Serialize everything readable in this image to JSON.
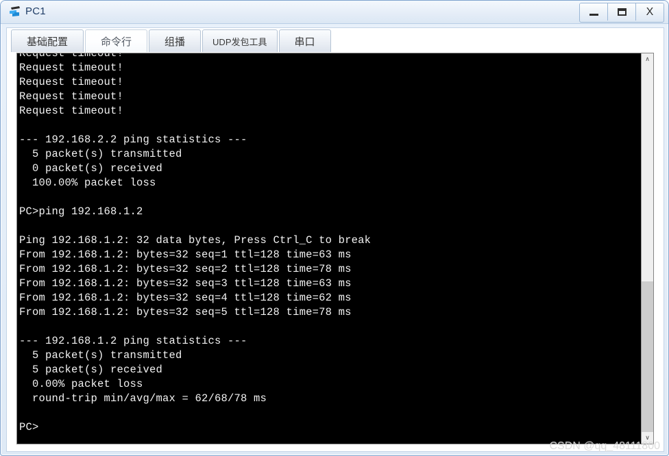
{
  "window": {
    "title": "PC1",
    "icon": "pc-device-icon",
    "controls": {
      "minimize": "—",
      "maximize": "❐",
      "close": "X"
    }
  },
  "tabs": [
    {
      "label": "基础配置",
      "active": false,
      "small": false
    },
    {
      "label": "命令行",
      "active": true,
      "small": false
    },
    {
      "label": "组播",
      "active": false,
      "small": false
    },
    {
      "label": "UDP发包工具",
      "active": false,
      "small": true
    },
    {
      "label": "串口",
      "active": false,
      "small": false
    }
  ],
  "console": {
    "lines": [
      "Request timeout!",
      "Request timeout!",
      "Request timeout!",
      "Request timeout!",
      "Request timeout!",
      "",
      "--- 192.168.2.2 ping statistics ---",
      "  5 packet(s) transmitted",
      "  0 packet(s) received",
      "  100.00% packet loss",
      "",
      "PC>ping 192.168.1.2",
      "",
      "Ping 192.168.1.2: 32 data bytes, Press Ctrl_C to break",
      "From 192.168.1.2: bytes=32 seq=1 ttl=128 time=63 ms",
      "From 192.168.1.2: bytes=32 seq=2 ttl=128 time=78 ms",
      "From 192.168.1.2: bytes=32 seq=3 ttl=128 time=63 ms",
      "From 192.168.1.2: bytes=32 seq=4 ttl=128 time=62 ms",
      "From 192.168.1.2: bytes=32 seq=5 ttl=128 time=78 ms",
      "",
      "--- 192.168.1.2 ping statistics ---",
      "  5 packet(s) transmitted",
      "  5 packet(s) received",
      "  0.00% packet loss",
      "  round-trip min/avg/max = 62/68/78 ms",
      "",
      "PC>"
    ],
    "text": "Request timeout!\nRequest timeout!\nRequest timeout!\nRequest timeout!\nRequest timeout!\n\n--- 192.168.2.2 ping statistics ---\n  5 packet(s) transmitted\n  0 packet(s) received\n  100.00% packet loss\n\nPC>ping 192.168.1.2\n\nPing 192.168.1.2: 32 data bytes, Press Ctrl_C to break\nFrom 192.168.1.2: bytes=32 seq=1 ttl=128 time=63 ms\nFrom 192.168.1.2: bytes=32 seq=2 ttl=128 time=78 ms\nFrom 192.168.1.2: bytes=32 seq=3 ttl=128 time=63 ms\nFrom 192.168.1.2: bytes=32 seq=4 ttl=128 time=62 ms\nFrom 192.168.1.2: bytes=32 seq=5 ttl=128 time=78 ms\n\n--- 192.168.1.2 ping statistics ---\n  5 packet(s) transmitted\n  5 packet(s) received\n  0.00% packet loss\n  round-trip min/avg/max = 62/68/78 ms\n\nPC>",
    "background": "#000000",
    "foreground": "#f2f2f2"
  },
  "scrollbar": {
    "up_arrow": "∧",
    "down_arrow": "∨"
  },
  "watermark": {
    "text": "CSDN @qq_48111800"
  }
}
